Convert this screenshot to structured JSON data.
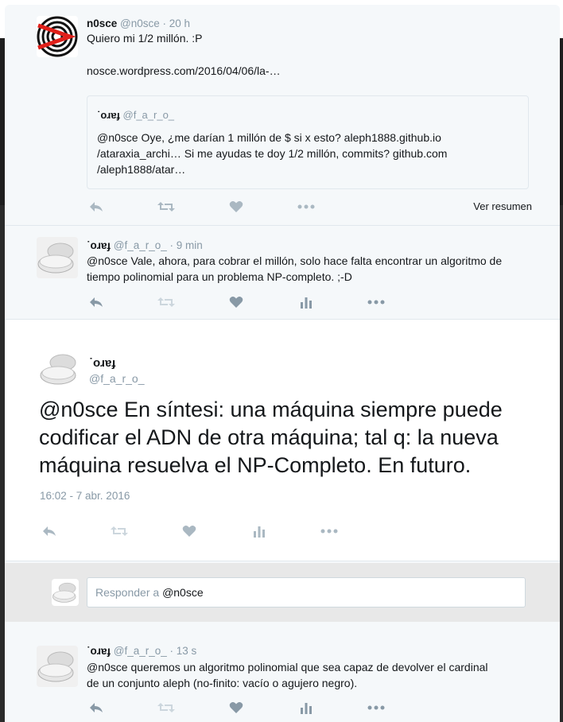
{
  "tweets": {
    "t1": {
      "name": "n0sce",
      "handle": "@n0sce",
      "time": "· 20 h",
      "text_line1": "Quiero mi 1/2 millón. :P",
      "text_line2": "nosce.wordpress.com/2016/04/06/la-…",
      "quote": {
        "name": "˙oɹɐɟ",
        "handle": "@f_a_r_o_",
        "text": "@n0sce Oye, ¿me darían 1 millón de $ si x esto? aleph1888.github.io /ataraxia_archi… Si me ayudas te doy 1/2 millón, commits? github.com /aleph1888/atar…"
      },
      "summary_link": "Ver resumen"
    },
    "t2": {
      "name": "˙oɹɐɟ",
      "handle": "@f_a_r_o_",
      "time": "· 9 min",
      "text": "@n0sce Vale, ahora, para cobrar el millón, solo hace falta encontrar un algoritmo de tiempo polinomial para un problema NP-completo. ;-D"
    },
    "focused": {
      "name": "˙oɹɐɟ",
      "handle": "@f_a_r_o_",
      "text": "@n0sce En síntesi: una máquina siempre puede codificar el ADN de otra máquina; tal q: la nueva máquina resuelva el NP-Completo. En futuro.",
      "timestamp": "16:02 - 7 abr. 2016"
    },
    "t3": {
      "name": "˙oɹɐɟ",
      "handle": "@f_a_r_o_",
      "time": "· 13 s",
      "text": "@n0sce queremos un  algoritmo polinomial que sea capaz de devolver el cardinal de un conjunto aleph (no-finito: vacío o agujero negro)."
    }
  },
  "reply": {
    "prefix": "Responder a",
    "mention": "@n0sce"
  },
  "icons": [
    "reply-icon",
    "retweet-icon",
    "like-icon",
    "analytics-icon",
    "more-icon"
  ],
  "colors": {
    "icon_gray": "#aab8c2",
    "icon_dark": "#8899a6",
    "text": "#14171a",
    "meta": "#8899a6",
    "panel": "#f5f8fa",
    "reply_bar": "#e8e8e8"
  }
}
